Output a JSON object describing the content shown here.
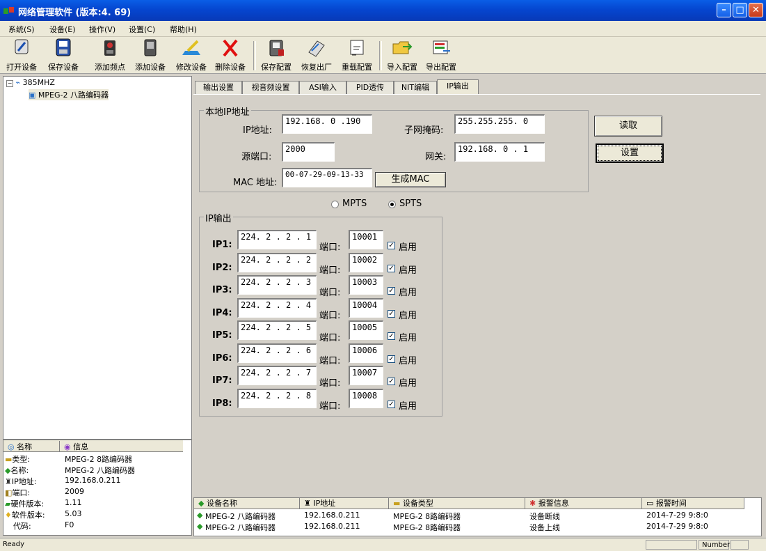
{
  "window": {
    "title": "网络管理软件 (版本:4. 69)"
  },
  "menu": [
    "系统(S)",
    "设备(E)",
    "操作(V)",
    "设置(C)",
    "帮助(H)"
  ],
  "toolbar": [
    "打开设备",
    "保存设备",
    "添加频点",
    "添加设备",
    "修改设备",
    "删除设备",
    "保存配置",
    "恢复出厂",
    "重载配置",
    "导入配置",
    "导出配置"
  ],
  "tree": {
    "root": "385MHZ",
    "child": "MPEG-2 八路编码器"
  },
  "info": {
    "col_name": "名称",
    "col_info": "信息",
    "rows": [
      {
        "k": "类型:",
        "v": "MPEG-2 8路编码器"
      },
      {
        "k": "名称:",
        "v": "MPEG-2 八路编码器"
      },
      {
        "k": "IP地址:",
        "v": "192.168.0.211"
      },
      {
        "k": "端口:",
        "v": "2009"
      },
      {
        "k": "硬件版本:",
        "v": "1.11"
      },
      {
        "k": "软件版本:",
        "v": "5.03"
      },
      {
        "k": "代码:",
        "v": "F0"
      }
    ]
  },
  "tabs": [
    "输出设置",
    "视音频设置",
    "ASI输入",
    "PID透传",
    "NIT编辑",
    "IP输出"
  ],
  "local_ip": {
    "group_title": "本地IP地址",
    "ip_label": "IP地址:",
    "ip_value": "192.168. 0 .190",
    "mask_label": "子网掩码:",
    "mask_value": "255.255.255. 0",
    "port_label": "源端口:",
    "port_value": "2000",
    "gateway_label": "网关:",
    "gateway_value": "192.168. 0 . 1",
    "mac_label": "MAC 地址:",
    "mac_value": "00-07-29-09-13-33",
    "gen_mac_label": "生成MAC"
  },
  "buttons": {
    "read": "读取",
    "set": "设置"
  },
  "mode": {
    "mpts": "MPTS",
    "spts": "SPTS",
    "selected": "SPTS"
  },
  "ip_output": {
    "group_title": "IP输出",
    "port_label": "端口:",
    "enable_label": "启用",
    "rows": [
      {
        "label": "IP1:",
        "ip": "224. 2 . 2 . 1",
        "port": "10001",
        "enabled": true
      },
      {
        "label": "IP2:",
        "ip": "224. 2 . 2 . 2",
        "port": "10002",
        "enabled": true
      },
      {
        "label": "IP3:",
        "ip": "224. 2 . 2 . 3",
        "port": "10003",
        "enabled": true
      },
      {
        "label": "IP4:",
        "ip": "224. 2 . 2 . 4",
        "port": "10004",
        "enabled": true
      },
      {
        "label": "IP5:",
        "ip": "224. 2 . 2 . 5",
        "port": "10005",
        "enabled": true
      },
      {
        "label": "IP6:",
        "ip": "224. 2 . 2 . 6",
        "port": "10006",
        "enabled": true
      },
      {
        "label": "IP7:",
        "ip": "224. 2 . 2 . 7",
        "port": "10007",
        "enabled": true
      },
      {
        "label": "IP8:",
        "ip": "224. 2 . 2 . 8",
        "port": "10008",
        "enabled": true
      }
    ]
  },
  "alarms": {
    "columns": [
      "设备名称",
      "IP地址",
      "设备类型",
      "报警信息",
      "报警时间"
    ],
    "rows": [
      [
        "MPEG-2 八路编码器",
        "192.168.0.211",
        "MPEG-2 8路编码器",
        "设备断线",
        "2014-7-29 9:8:0"
      ],
      [
        "MPEG-2 八路编码器",
        "192.168.0.211",
        "MPEG-2 8路编码器",
        "设备上线",
        "2014-7-29 9:8:0"
      ]
    ]
  },
  "status": {
    "text": "Ready",
    "num": "Number"
  }
}
